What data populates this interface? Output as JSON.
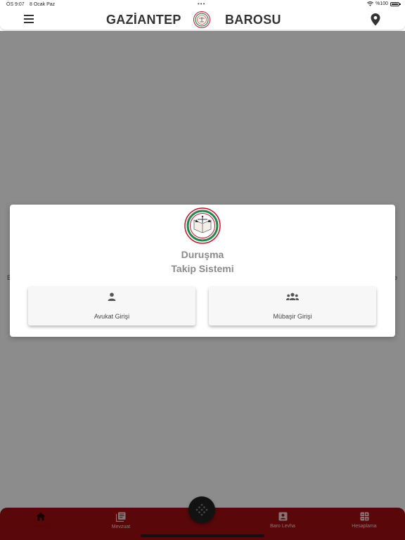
{
  "status_bar": {
    "time": "ÖS 9:07",
    "date": "8 Ocak Paz",
    "dots": "•••",
    "battery": "%100"
  },
  "header": {
    "title_left": "GAZİANTEP",
    "title_right": "BAROSU"
  },
  "modal": {
    "title_line1": "Duruşma",
    "title_line2": "Takip Sistemi",
    "avukat_label": "Avukat Girişi",
    "mubasir_label": "Mübaşir Girişi"
  },
  "bottom_nav": {
    "items": [
      {
        "label": "Anasayfa"
      },
      {
        "label": "Mevzuat"
      },
      {
        "label": "Baro Levha"
      },
      {
        "label": "Hesaplama"
      }
    ]
  },
  "colors": {
    "brand_red": "#a30d12",
    "logo_green": "#1f8a4c",
    "logo_red": "#c8102e"
  }
}
